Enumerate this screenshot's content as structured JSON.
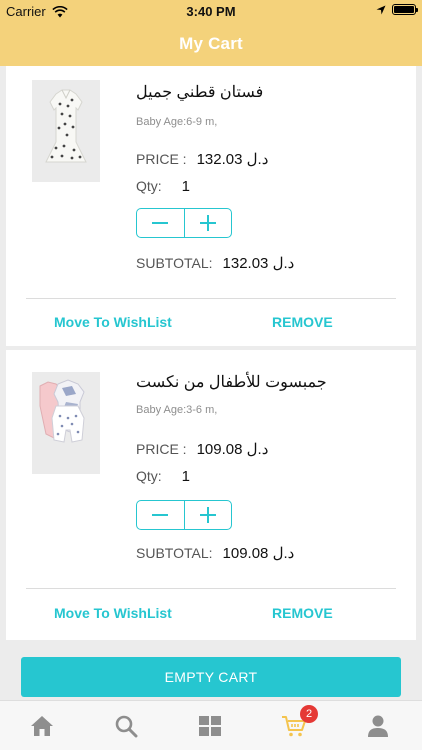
{
  "status_bar": {
    "carrier": "Carrier",
    "time": "3:40 PM"
  },
  "header": {
    "title": "My Cart"
  },
  "cart": {
    "items": [
      {
        "name": "فستان قطني جميل",
        "age": "Baby Age:6-9 m,",
        "price_label": "PRICE :",
        "price": "132.03 د.ل",
        "qty_label": "Qty:",
        "qty": "1",
        "subtotal_label": "SUBTOTAL:",
        "subtotal": "132.03 د.ل",
        "wishlist_label": "Move To WishList",
        "remove_label": "REMOVE"
      },
      {
        "name": "جمبسوت للأطفال من نكست",
        "age": "Baby Age:3-6 m,",
        "price_label": "PRICE :",
        "price": "109.08 د.ل",
        "qty_label": "Qty:",
        "qty": "1",
        "subtotal_label": "SUBTOTAL:",
        "subtotal": "109.08 د.ل",
        "wishlist_label": "Move To WishList",
        "remove_label": "REMOVE"
      }
    ],
    "empty_button_label": "EMPTY CART"
  },
  "tab_bar": {
    "tabs": [
      {
        "icon": "home-icon"
      },
      {
        "icon": "search-icon"
      },
      {
        "icon": "categories-icon"
      },
      {
        "icon": "cart-icon",
        "badge": "2",
        "active": true
      },
      {
        "icon": "profile-icon"
      }
    ]
  },
  "colors": {
    "header": "#f4d27b",
    "accent": "#26c6d0",
    "badge": "#e53935",
    "active_tab": "#f4c44e",
    "inactive_tab": "#8e8e8e"
  }
}
